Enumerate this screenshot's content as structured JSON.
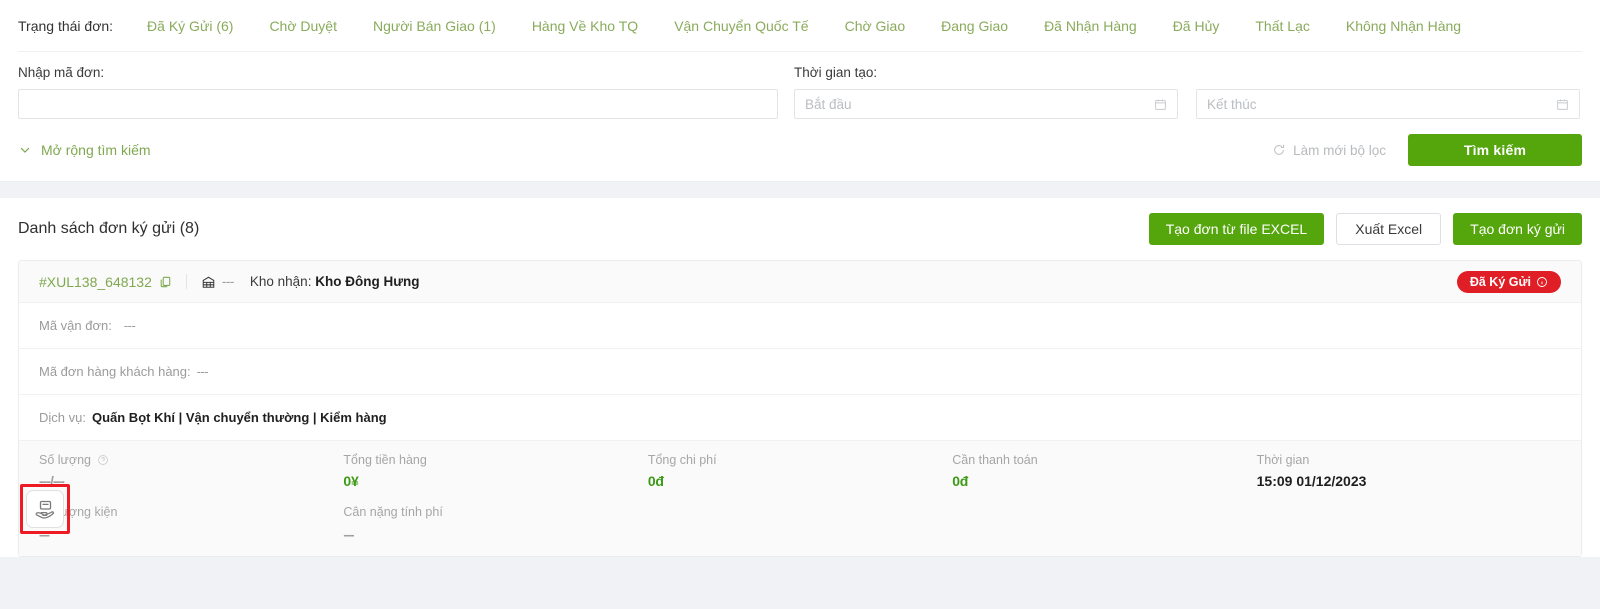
{
  "filter": {
    "status_label": "Trạng thái đơn:",
    "tabs": [
      {
        "label": "Đã Ký Gửi (6)",
        "name": "tab-da-ky-gui"
      },
      {
        "label": "Chờ Duyệt",
        "name": "tab-cho-duyet"
      },
      {
        "label": "Người Bán Giao (1)",
        "name": "tab-nguoi-ban-giao"
      },
      {
        "label": "Hàng Về Kho TQ",
        "name": "tab-hang-ve-kho-tq"
      },
      {
        "label": "Vận Chuyển Quốc Tế",
        "name": "tab-van-chuyen-quoc-te"
      },
      {
        "label": "Chờ Giao",
        "name": "tab-cho-giao"
      },
      {
        "label": "Đang Giao",
        "name": "tab-dang-giao"
      },
      {
        "label": "Đã Nhận Hàng",
        "name": "tab-da-nhan-hang"
      },
      {
        "label": "Đã Hủy",
        "name": "tab-da-huy"
      },
      {
        "label": "Thất Lạc",
        "name": "tab-that-lac"
      },
      {
        "label": "Không Nhận Hàng",
        "name": "tab-khong-nhan-hang"
      }
    ],
    "order_code_label": "Nhập mã đơn:",
    "order_code_value": "",
    "order_code_placeholder": "",
    "created_time_label": "Thời gian tạo:",
    "date_from_placeholder": "Bắt đầu",
    "date_from_value": "",
    "date_to_placeholder": "Kết thúc",
    "date_to_value": "",
    "expand_label": "Mở rộng tìm kiếm",
    "reset_label": "Làm mới bộ lọc",
    "search_label": "Tìm kiếm"
  },
  "list": {
    "title": "Danh sách đơn ký gửi (8)",
    "btn_create_from_excel": "Tạo đơn từ file EXCEL",
    "btn_export_excel": "Xuất Excel",
    "btn_create_order": "Tạo đơn ký gửi"
  },
  "order": {
    "id": "#XUL138_648132",
    "header_dash": "---",
    "warehouse_label": "Kho nhận:",
    "warehouse_value": "Kho Đông Hưng",
    "status_badge": "Đã Ký Gửi",
    "tracking_label": "Mã vận đơn:",
    "tracking_value": "---",
    "customer_order_label": "Mã đơn hàng khách hàng:",
    "customer_order_value": "---",
    "service_label": "Dịch vụ:",
    "service_value": "Quấn Bọt Khí | Vận chuyển thường | Kiểm hàng",
    "stats": [
      {
        "label": "Số lượng",
        "value": "---/---",
        "value_style": "muted",
        "has_info": true,
        "sub_label": "Số lượng kiện",
        "sub_value": "---"
      },
      {
        "label": "Tổng tiền hàng",
        "value": "0¥",
        "value_style": "green",
        "has_info": false,
        "sub_label": "Cân nặng tính phí",
        "sub_value": "---"
      },
      {
        "label": "Tổng chi phí",
        "value": "0đ",
        "value_style": "green",
        "has_info": false,
        "sub_label": "",
        "sub_value": ""
      },
      {
        "label": "Cần thanh toán",
        "value": "0đ",
        "value_style": "green",
        "has_info": false,
        "sub_label": "",
        "sub_value": ""
      },
      {
        "label": "Thời gian",
        "value": "15:09 01/12/2023",
        "value_style": "dark",
        "has_info": false,
        "sub_label": "",
        "sub_value": ""
      }
    ]
  },
  "icons": {
    "copy": "copy-icon",
    "warehouse": "warehouse-icon",
    "calendar": "calendar-icon",
    "chevron_down": "chevron-down-icon",
    "refresh": "refresh-icon",
    "info": "info-circle-icon",
    "package_hand": "package-in-hand-icon"
  },
  "colors": {
    "green": "#55a50d",
    "tab_green": "#8aab5c",
    "badge_red": "#e01e26",
    "highlight_red": "#ee1b24"
  }
}
